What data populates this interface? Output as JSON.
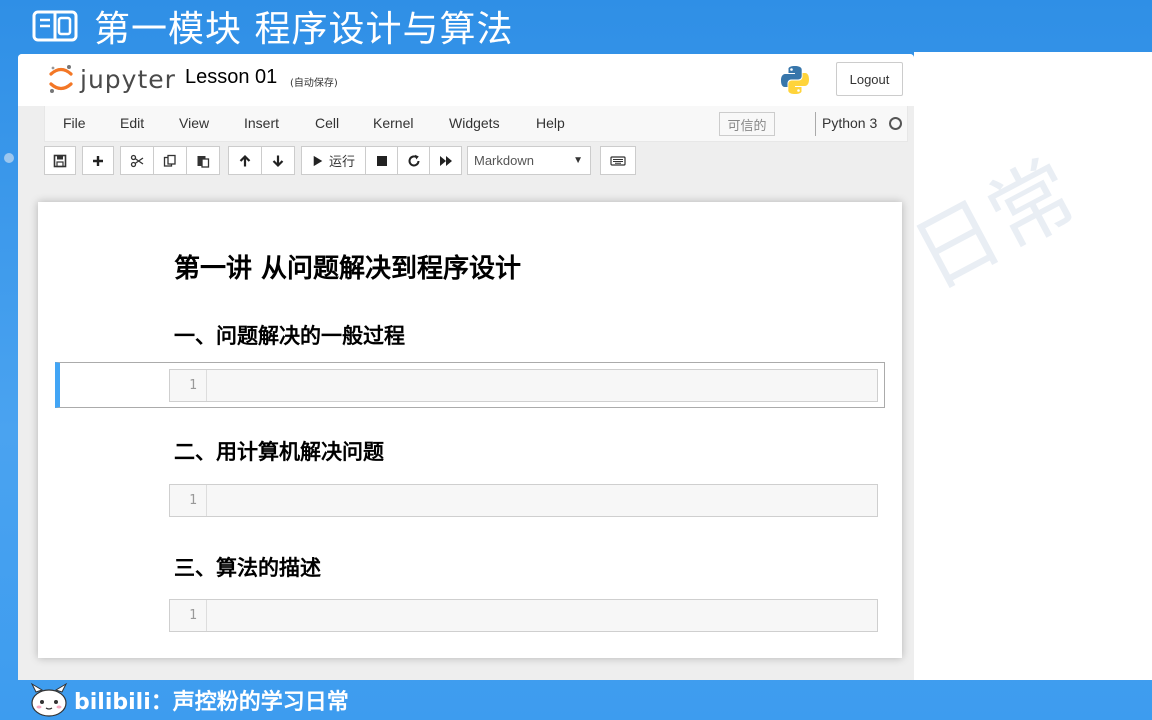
{
  "banner": {
    "title": "第一模块 程序设计与算法"
  },
  "watermark": "日常",
  "header": {
    "logo_text": "jupyter",
    "notebook_name": "Lesson 01",
    "autosave": "(自动保存)",
    "logout_label": "Logout"
  },
  "menubar": {
    "items": [
      "File",
      "Edit",
      "View",
      "Insert",
      "Cell",
      "Kernel",
      "Widgets",
      "Help"
    ],
    "trusted": "可信的",
    "kernel": "Python 3"
  },
  "toolbar": {
    "run_label": "运行",
    "cell_type": "Markdown"
  },
  "notebook": {
    "heading1": "第一讲 从问题解决到程序设计",
    "sections": [
      {
        "heading": "一、问题解决的一般过程",
        "line": "1"
      },
      {
        "heading": "二、用计算机解决问题",
        "line": "1"
      },
      {
        "heading": "三、算法的描述",
        "line": "1"
      }
    ]
  },
  "footer": {
    "text": "bilibili：声控粉的学习日常"
  }
}
